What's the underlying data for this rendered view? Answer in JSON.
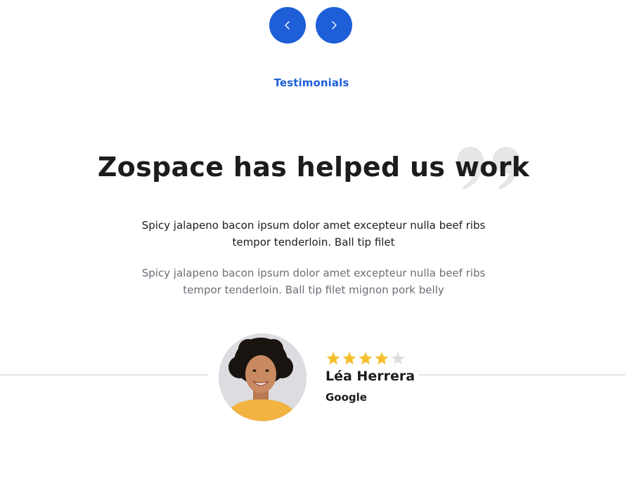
{
  "slider": {
    "prev_icon": "chevron-left-icon",
    "next_icon": "chevron-right-icon"
  },
  "section": {
    "eyebrow": "Testimonials"
  },
  "testimonial": {
    "headline": "Zospace has helped us work",
    "quote_icon": "quote-mark-icon",
    "quote_primary": "Spicy jalapeno bacon ipsum dolor amet excepteur nulla beef ribs tempor tenderloin. Ball tip filet",
    "quote_secondary": "Spicy jalapeno bacon ipsum dolor amet excepteur nulla beef ribs tempor tenderloin. Ball tip filet mignon pork belly",
    "rating": 4,
    "rating_max": 5,
    "author": {
      "name": "Léa Herrera",
      "company": "Google",
      "avatar_icon": "avatar"
    }
  },
  "colors": {
    "accent": "#1e5fd8",
    "star_filled": "#f4bf2b",
    "star_empty": "#dedede",
    "muted_text": "#6b6f76",
    "quote_mark": "#e6e6e6"
  }
}
